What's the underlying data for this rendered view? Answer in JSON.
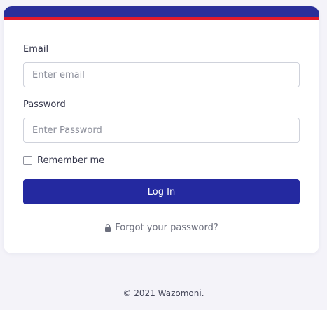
{
  "login_form": {
    "email_label": "Email",
    "email_placeholder": "Enter email",
    "email_value": "",
    "password_label": "Password",
    "password_placeholder": "Enter Password",
    "password_value": "",
    "remember_label": "Remember me",
    "remember_checked": false,
    "login_button_label": "Log In",
    "forgot_link_label": "Forgot your password?",
    "forgot_icon": "lock-icon"
  },
  "header": {
    "accent_color": "#2a2f9a",
    "stripe_color": "#e11a2a"
  },
  "footer": {
    "copyright": "© 2021 Wazomoni."
  }
}
